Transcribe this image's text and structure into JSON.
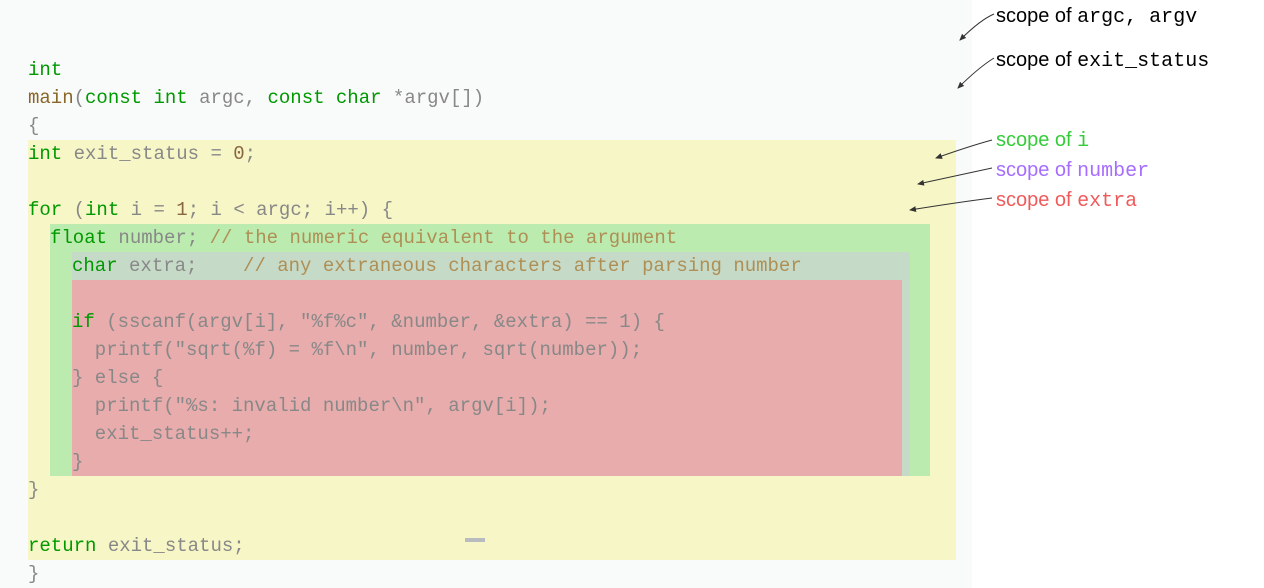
{
  "code": {
    "l1_int": "int",
    "l2_main": "main",
    "l2_paren_open": "(",
    "l2_const1": "const",
    "l2_int1": "int",
    "l2_argc": "argc",
    "l2_comma": ",",
    "l2_const2": "const",
    "l2_char": "char",
    "l2_star": "*",
    "l2_argv": "argv",
    "l2_brackets": "[]",
    "l2_paren_close": ")",
    "l3_brace": "{",
    "l4_int": "int",
    "l4_exit": "exit_status",
    "l4_eq": "=",
    "l4_zero": "0",
    "l4_semi": ";",
    "l6_for": "for",
    "l6_open": " (",
    "l6_int": "int",
    "l6_i1": "i",
    "l6_eq": "=",
    "l6_one": "1",
    "l6_semi1": ";",
    "l6_i2": "i",
    "l6_lt": "<",
    "l6_argc": "argc",
    "l6_semi2": ";",
    "l6_i3": "i",
    "l6_pp": "++)",
    "l6_brace": " {",
    "l7_float": "float",
    "l7_number": "number",
    "l7_semi": ";",
    "l7_cm": "// the numeric equivalent to the argument",
    "l8_char": "char",
    "l8_extra": "extra",
    "l8_semi": ";",
    "l8_cm": "// any extraneous characters after parsing number",
    "l10_if": "if",
    "l10_rest": "(sscanf(argv[i], \"%f%c\", &number, &extra) == 1) {",
    "l11": "  printf(\"sqrt(%f) = %f\\n\", number, sqrt(number));",
    "l12_else": "} else {",
    "l13": "  printf(\"%s: invalid number\\n\", argv[i]);",
    "l14": "  exit_status++;",
    "l15_brace": "}",
    "l16_brace": "}",
    "l18_return": "return",
    "l18_exit": "exit_status",
    "l18_semi": ";",
    "l19_brace": "}"
  },
  "annotations": {
    "argc_argv_pre": "scope of ",
    "argc_argv_code": "argc,  argv",
    "exit_pre": "scope of ",
    "exit_code": "exit_status",
    "i_pre": "scope of ",
    "i_code": "i",
    "number_pre": "scope of ",
    "number_code": "number",
    "extra_pre": "scope of ",
    "extra_code": "extra"
  }
}
